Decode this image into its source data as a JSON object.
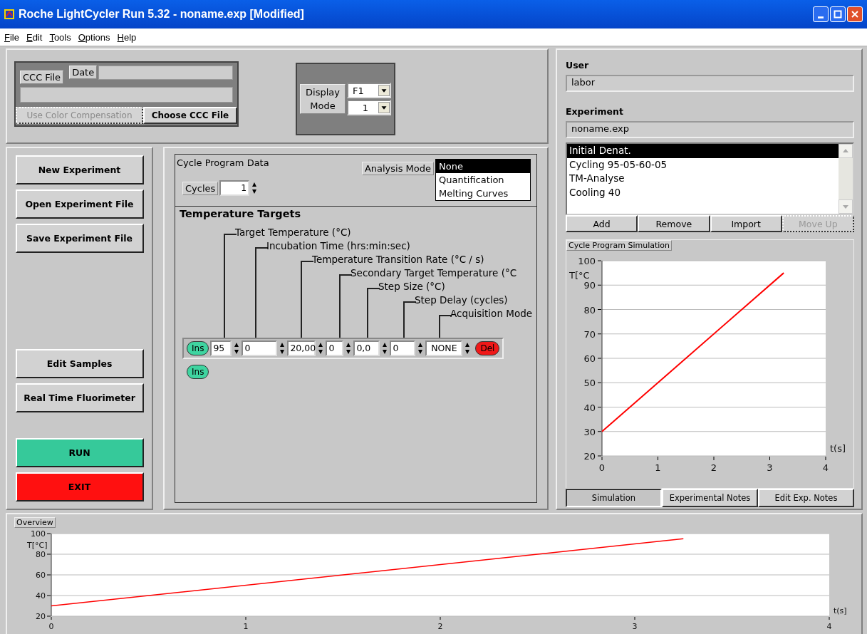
{
  "window": {
    "title": "Roche LightCycler Run 5.32 - noname.exp [Modified]"
  },
  "menu": [
    "File",
    "Edit",
    "Tools",
    "Options",
    "Help"
  ],
  "ccc": {
    "file_label": "CCC File",
    "date_label": "Date",
    "use_color_compensation": {
      "label": "Use Color Compensation",
      "disabled": true
    },
    "choose_button": "Choose CCC File"
  },
  "display_mode": {
    "label": "Display Mode",
    "channel": "F1",
    "value": "1"
  },
  "actions": [
    {
      "label": "New Experiment",
      "kind": "normal"
    },
    {
      "label": "Open Experiment File",
      "kind": "normal"
    },
    {
      "label": "Save Experiment File",
      "kind": "normal"
    },
    {
      "label": "Edit Samples",
      "kind": "normal"
    },
    {
      "label": "Real Time Fluorimeter",
      "kind": "normal"
    },
    {
      "label": "RUN",
      "kind": "run"
    },
    {
      "label": "EXIT",
      "kind": "exit"
    }
  ],
  "cycle_program": {
    "title": "Cycle Program Data",
    "cycles_label": "Cycles",
    "cycles": "1",
    "analysis_mode_label": "Analysis Mode",
    "analysis_modes": [
      {
        "label": "None",
        "selected": true
      },
      {
        "label": "Quantification",
        "selected": false
      },
      {
        "label": "Melting Curves",
        "selected": false
      }
    ]
  },
  "temperature_targets": {
    "title": "Temperature Targets",
    "columns": [
      "Target Temperature (°C)",
      "Incubation Time (hrs:min:sec)",
      "Temperature Transition Rate (°C / s)",
      "Secondary Target Temperature (°C",
      "Step Size (°C)",
      "Step Delay (cycles)",
      "Acquisition Mode"
    ],
    "rows": [
      {
        "insert": "Ins",
        "values": [
          "95",
          "0",
          "20,00",
          "0",
          "0,0",
          "0",
          "NONE"
        ],
        "delete": "Del"
      }
    ],
    "insert_button": "Ins"
  },
  "user": {
    "label": "User",
    "value": "labor"
  },
  "experiment": {
    "label": "Experiment",
    "value": "noname.exp",
    "programs": [
      {
        "label": "Initial Denat.",
        "selected": true
      },
      {
        "label": "Cycling 95-05-60-05",
        "selected": false
      },
      {
        "label": "TM-Analyse",
        "selected": false
      },
      {
        "label": "Cooling 40",
        "selected": false
      }
    ],
    "buttons": [
      {
        "label": "Add",
        "disabled": false
      },
      {
        "label": "Remove",
        "disabled": false
      },
      {
        "label": "Import",
        "disabled": false
      },
      {
        "label": "Move Up",
        "disabled": true
      }
    ]
  },
  "simulation": {
    "title": "Cycle Program Simulation",
    "chart_data": {
      "type": "line",
      "xlabel": "t(s]",
      "ylabel": "T[°C",
      "x": [
        0,
        3.25
      ],
      "series": [
        {
          "color": "#ff0000",
          "values": [
            30,
            95
          ]
        }
      ],
      "xlim": [
        0,
        4
      ],
      "ylim": [
        20,
        100
      ],
      "xticks": [
        0,
        1,
        2,
        3,
        4
      ],
      "yticks": [
        20,
        30,
        40,
        50,
        60,
        70,
        80,
        90,
        100
      ],
      "grid": true
    },
    "tabs": [
      {
        "label": "Simulation",
        "selected": true
      },
      {
        "label": "Experimental Notes",
        "selected": false
      },
      {
        "label": "Edit Exp. Notes",
        "selected": false
      }
    ]
  },
  "overview": {
    "title": "Overview",
    "chart_data": {
      "type": "line",
      "xlabel": "t(s]",
      "ylabel": "T[°C]",
      "x": [
        0,
        3.25
      ],
      "series": [
        {
          "color": "#ff0000",
          "values": [
            30,
            95
          ]
        }
      ],
      "xlim": [
        0,
        4
      ],
      "ylim": [
        20,
        100
      ],
      "xticks": [
        0,
        1,
        2,
        3,
        4
      ],
      "yticks": [
        20,
        40,
        60,
        80,
        100
      ],
      "grid": true
    }
  }
}
